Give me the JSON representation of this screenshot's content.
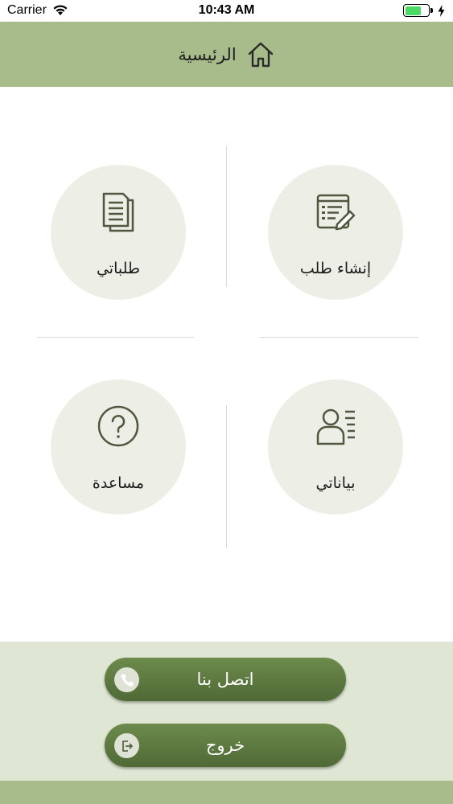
{
  "status_bar": {
    "carrier": "Carrier",
    "time": "10:43 AM",
    "battery_level": 0.7
  },
  "header": {
    "title": "الرئيسية",
    "icon": "home-icon"
  },
  "tiles": [
    {
      "label": "إنشاء طلب",
      "icon": "create-request-icon"
    },
    {
      "label": "طلباتي",
      "icon": "documents-icon"
    },
    {
      "label": "بياناتي",
      "icon": "profile-list-icon"
    },
    {
      "label": "مساعدة",
      "icon": "help-icon"
    }
  ],
  "footer": {
    "contact_label": "اتصل بنا",
    "contact_icon": "phone-icon",
    "logout_label": "خروج",
    "logout_icon": "logout-icon"
  },
  "colors": {
    "header_bg": "#a8bb8b",
    "tile_bg": "#edefe7",
    "footer_bg": "#dfe6d3",
    "button_green": "#5c7840",
    "icon_color": "#4f573f"
  }
}
